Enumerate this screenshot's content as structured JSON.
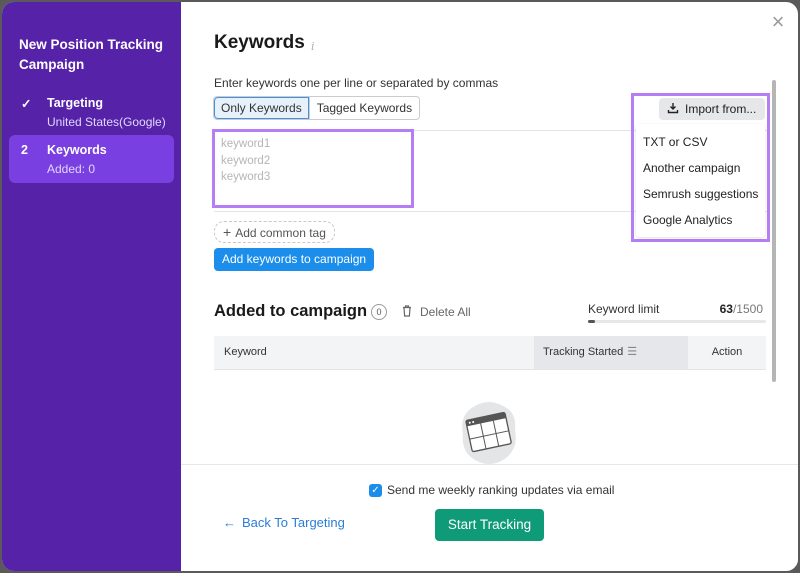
{
  "sidebar": {
    "title": "New Position Tracking Campaign",
    "steps": [
      {
        "marker": "✓",
        "label": "Targeting",
        "sub": "United States(Google)"
      },
      {
        "marker": "2",
        "label": "Keywords",
        "sub": "Added: 0"
      }
    ]
  },
  "main": {
    "title": "Keywords",
    "info_icon": "i",
    "hint": "Enter keywords one per line or separated by commas",
    "tabs": [
      {
        "label": "Only Keywords",
        "active": true
      },
      {
        "label": "Tagged Keywords",
        "active": false
      }
    ],
    "keyword_placeholder": [
      "keyword1",
      "keyword2",
      "keyword3"
    ],
    "add_common_tag": "Add common tag",
    "add_keywords_button": "Add keywords to campaign",
    "import": {
      "button": "Import from...",
      "options": [
        "TXT or CSV",
        "Another campaign",
        "Semrush suggestions",
        "Google Analytics"
      ]
    },
    "added": {
      "title": "Added to campaign",
      "count": "0",
      "delete_all": "Delete All",
      "limit_label": "Keyword limit",
      "limit_used": "63",
      "limit_total": "/1500",
      "limit_fraction": 0.042,
      "columns": [
        "Keyword",
        "Tracking Started",
        "Action"
      ]
    }
  },
  "footer": {
    "email_checkbox_checked": true,
    "email_checkbox_label": "Send me weekly ranking updates via email",
    "back_link": "Back To Targeting",
    "start_button": "Start Tracking"
  },
  "colors": {
    "sidebar_bg": "#5522a8",
    "active_step_bg": "#7a3fe0",
    "primary_blue": "#1b8dea",
    "start_green": "#0f9b78",
    "highlight_purple": "#b57ef5"
  }
}
